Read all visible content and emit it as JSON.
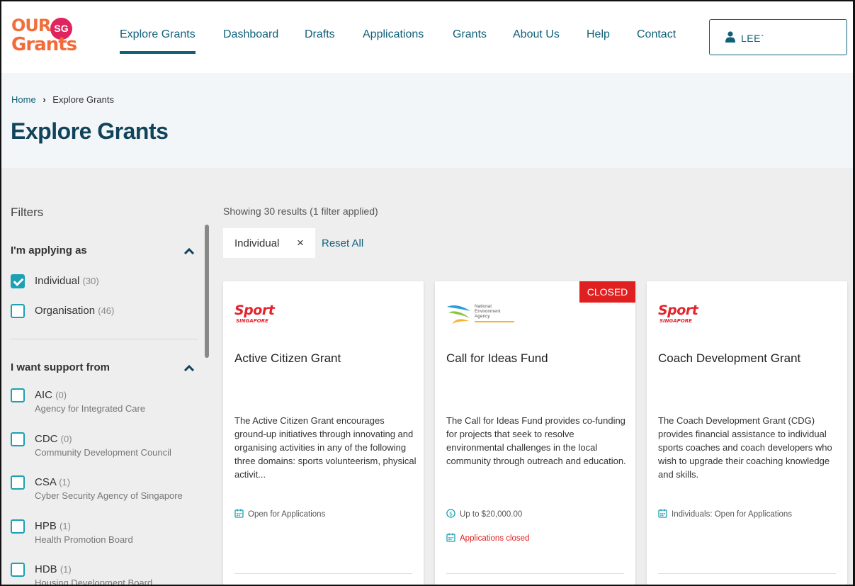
{
  "logo": {
    "our": "OUR",
    "sg": "SG",
    "grants": "Grants"
  },
  "nav": {
    "items": [
      {
        "label": "Explore Grants",
        "active": true
      },
      {
        "label": "Dashboard"
      },
      {
        "label": "Drafts"
      },
      {
        "label": "Applications"
      },
      {
        "label": "Grants"
      },
      {
        "label": "About Us"
      },
      {
        "label": "Help"
      },
      {
        "label": "Contact"
      }
    ]
  },
  "user": {
    "name": "LEE`",
    "icon": "user-icon"
  },
  "breadcrumb": {
    "home": "Home",
    "current": "Explore Grants"
  },
  "page_title": "Explore Grants",
  "filters": {
    "title": "Filters",
    "applying_as": {
      "title": "I'm applying as",
      "options": [
        {
          "label": "Individual",
          "count": "(30)",
          "checked": true
        },
        {
          "label": "Organisation",
          "count": "(46)",
          "checked": false
        }
      ]
    },
    "support_from": {
      "title": "I want support from",
      "options": [
        {
          "label": "AIC",
          "count": "(0)",
          "sub": "Agency for Integrated Care"
        },
        {
          "label": "CDC",
          "count": "(0)",
          "sub": "Community Development Council"
        },
        {
          "label": "CSA",
          "count": "(1)",
          "sub": "Cyber Security Agency of Singapore"
        },
        {
          "label": "HPB",
          "count": "(1)",
          "sub": "Health Promotion Board"
        },
        {
          "label": "HDB",
          "count": "(1)",
          "sub": "Housing Development Board"
        }
      ]
    }
  },
  "results": {
    "summary": "Showing 30 results (1 filter applied)",
    "chip_label": "Individual",
    "chip_close": "×",
    "reset_all": "Reset All"
  },
  "cards": [
    {
      "agency_logo": {
        "line1": "Sport",
        "line2": "SINGAPORE"
      },
      "title": "Active Citizen Grant",
      "description": "The Active Citizen Grant encourages ground-up initiatives through innovating and organising activities in any of the following three domains: sports volunteerism, physical activit...",
      "meta": [
        {
          "icon": "calendar-icon",
          "text": "Open for Applications"
        }
      ]
    },
    {
      "badge": "CLOSED",
      "agency_logo": {
        "line1": "National",
        "line2": "Environment",
        "line3": "Agency"
      },
      "title": "Call for Ideas Fund",
      "description": "The Call for Ideas Fund provides co-funding for projects that seek to resolve environmental challenges in the local community through outreach and education.",
      "meta": [
        {
          "icon": "dollar-icon",
          "text": "Up to $20,000.00"
        },
        {
          "icon": "calendar-icon",
          "text": "Applications closed"
        }
      ]
    },
    {
      "agency_logo": {
        "line1": "Sport",
        "line2": "SINGAPORE"
      },
      "title": "Coach Development Grant",
      "description": "The Coach Development Grant (CDG) provides financial assistance to individual sports coaches and coach developers who wish to upgrade their coaching knowledge and skills.",
      "meta": [
        {
          "icon": "calendar-icon",
          "text": "Individuals: Open for Applications"
        }
      ]
    }
  ],
  "colors": {
    "brand_teal": "#11607a",
    "checkbox": "#1ca0b3",
    "closed_red": "#e02020",
    "logo_orange": "#f26a3a",
    "logo_pink": "#e0245e"
  }
}
